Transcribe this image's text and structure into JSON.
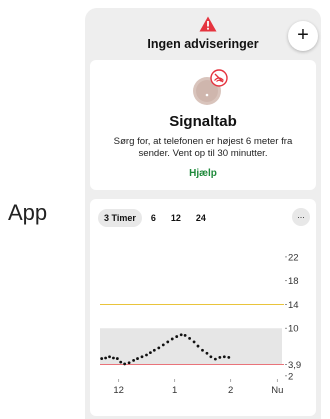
{
  "side_label": "App",
  "header": {
    "alert_title": "Ingen adviseringer",
    "add_label": "+"
  },
  "signal": {
    "title": "Signaltab",
    "message": "Sørg for, at telefonen er højest 6 meter fra sender. Vent op til 30 minutter.",
    "help_label": "Hjælp"
  },
  "chart": {
    "tabs": [
      {
        "label": "3 Timer",
        "active": true
      },
      {
        "label": "6",
        "active": false
      },
      {
        "label": "12",
        "active": false
      },
      {
        "label": "24",
        "active": false
      }
    ],
    "more_label": "..."
  },
  "colors": {
    "alert_red": "#e5343f",
    "help_green": "#1f8a3b",
    "high_line": "#e9c43b",
    "low_line": "#e9737a",
    "range_band": "#e6e6e6"
  },
  "chart_data": {
    "type": "scatter",
    "y_ticks": [
      {
        "label": "22",
        "value": 22
      },
      {
        "label": "18",
        "value": 18
      },
      {
        "label": "14",
        "value": 14
      },
      {
        "label": "10",
        "value": 10
      },
      {
        "label": "3,9",
        "value": 3.9
      },
      {
        "label": "2",
        "value": 2
      }
    ],
    "x_ticks": [
      {
        "label": "12",
        "t": 0.333
      },
      {
        "label": "1",
        "t": 1.333
      },
      {
        "label": "2",
        "t": 2.333
      },
      {
        "label": "Nu",
        "t": 3.167
      }
    ],
    "high_threshold": 14,
    "low_threshold": 3.9,
    "target_range": [
      3.9,
      10
    ],
    "ylim": [
      1.8,
      24
    ],
    "xlim": [
      0,
      3.25
    ],
    "points": [
      [
        0.03,
        4.9
      ],
      [
        0.1,
        5.0
      ],
      [
        0.17,
        5.2
      ],
      [
        0.24,
        5.0
      ],
      [
        0.31,
        4.9
      ],
      [
        0.37,
        4.3
      ],
      [
        0.44,
        4.0
      ],
      [
        0.52,
        4.2
      ],
      [
        0.6,
        4.6
      ],
      [
        0.67,
        4.9
      ],
      [
        0.75,
        5.2
      ],
      [
        0.83,
        5.5
      ],
      [
        0.9,
        5.9
      ],
      [
        0.97,
        6.3
      ],
      [
        1.05,
        6.7
      ],
      [
        1.13,
        7.2
      ],
      [
        1.21,
        7.7
      ],
      [
        1.29,
        8.2
      ],
      [
        1.37,
        8.6
      ],
      [
        1.45,
        8.9
      ],
      [
        1.52,
        8.8
      ],
      [
        1.6,
        8.3
      ],
      [
        1.68,
        7.7
      ],
      [
        1.75,
        7.0
      ],
      [
        1.83,
        6.3
      ],
      [
        1.91,
        5.8
      ],
      [
        1.98,
        5.2
      ],
      [
        2.06,
        4.8
      ],
      [
        2.14,
        5.1
      ],
      [
        2.22,
        5.2
      ],
      [
        2.3,
        5.1
      ]
    ]
  }
}
